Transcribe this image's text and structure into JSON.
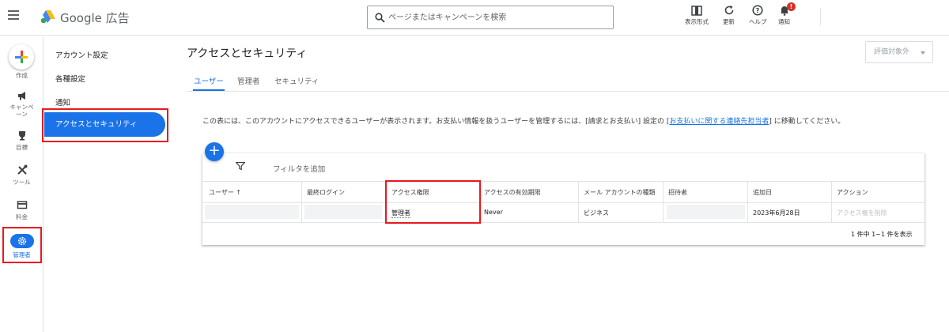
{
  "app": {
    "name": "Google 広告"
  },
  "search": {
    "placeholder": "ページまたはキャンペーンを検索"
  },
  "toolbar": {
    "view_label": "表示形式",
    "refresh_label": "更新",
    "help_label": "ヘルプ",
    "notifications_label": "通知",
    "notifications_badge": "!"
  },
  "rail": {
    "create": "作成",
    "campaigns": "キャンペーン",
    "goals": "目標",
    "tools": "ツール",
    "billing": "料金",
    "admin": "管理者"
  },
  "subnav": {
    "items": [
      "アカウント設定",
      "各種設定",
      "通知",
      "アクセスとセキュリティ"
    ]
  },
  "page": {
    "title": "アクセスとセキュリティ",
    "status_filter": "評価対象外",
    "tabs": [
      "ユーザー",
      "管理者",
      "セキュリティ"
    ],
    "description": "この表には、このアカウントにアクセスできるユーザーが表示されます。お支払い情報を扱うユーザーを管理するには、[請求とお支払い] 設定の [",
    "description_link": "お支払いに関する連絡先担当者",
    "description_end": "] に移動してください。",
    "add_button": "+",
    "filter_label": "フィルタを追加"
  },
  "table": {
    "headers": [
      "ユーザー ↑",
      "最終ログイン",
      "アクセス権限",
      "アクセスの有効期限",
      "メール アカウントの種類",
      "招待者",
      "追加日",
      "アクション"
    ],
    "row": {
      "access_level": "管理者",
      "expiration": "Never",
      "account_type": "ビジネス",
      "date_added": "2023年6月28日",
      "action": "アクセス権を削除"
    },
    "pagination": "1 件中 1~1 件を表示"
  },
  "colors": {
    "accent": "#1a73e8",
    "highlight": "#e8191e"
  }
}
